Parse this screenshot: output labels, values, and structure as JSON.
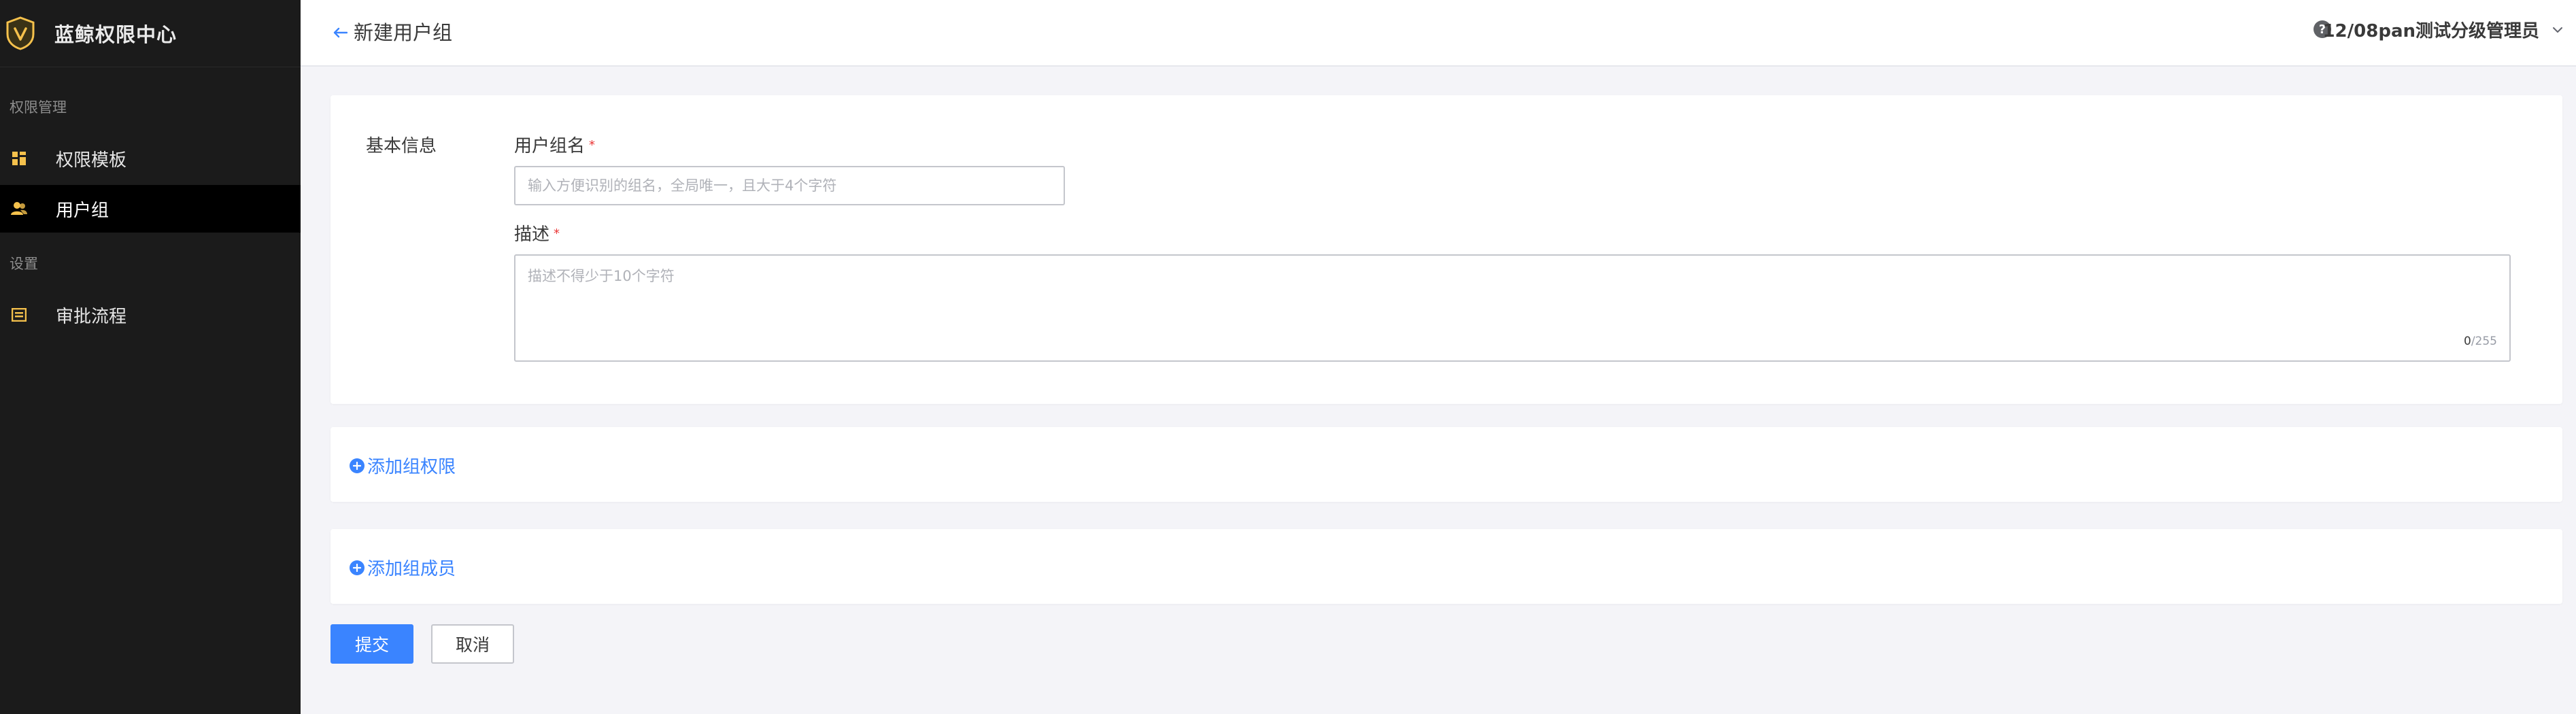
{
  "app": {
    "title": "蓝鲸权限中心"
  },
  "sidebar": {
    "groups": [
      {
        "label": "权限管理",
        "items": [
          {
            "label": "权限模板",
            "icon": "grid-icon",
            "active": false
          },
          {
            "label": "用户组",
            "icon": "users-icon",
            "active": true
          }
        ]
      },
      {
        "label": "设置",
        "items": [
          {
            "label": "审批流程",
            "icon": "approval-icon",
            "active": false
          }
        ]
      }
    ]
  },
  "header": {
    "title": "新建用户组",
    "help_label": "?",
    "user_name": "12/08pan测试分级管理员"
  },
  "form": {
    "section_title": "基本信息",
    "name_label": "用户组名",
    "name_placeholder": "输入方便识别的组名，全局唯一，且大于4个字符",
    "name_value": "",
    "desc_label": "描述",
    "desc_placeholder": "描述不得少于10个字符",
    "desc_value": "",
    "desc_count": "0",
    "desc_max": "/255",
    "required_mark": "*"
  },
  "actions": {
    "add_permission": "添加组权限",
    "add_member": "添加组成员",
    "submit": "提交",
    "cancel": "取消"
  },
  "colors": {
    "accent": "#3a84ff",
    "sidebar_bg": "#1b1b1b",
    "icon_gold": "#f5c14c"
  }
}
